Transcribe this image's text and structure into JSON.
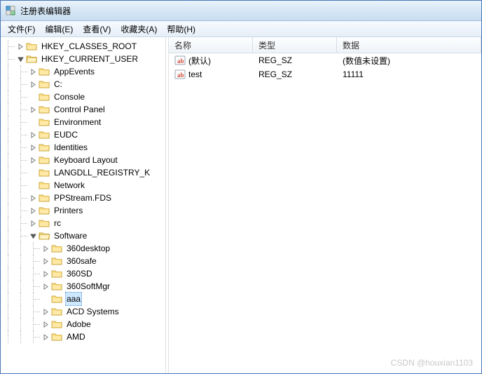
{
  "title": "注册表编辑器",
  "menus": [
    "文件(F)",
    "编辑(E)",
    "查看(V)",
    "收藏夹(A)",
    "帮助(H)"
  ],
  "columns": {
    "name": "名称",
    "type": "类型",
    "data": "数据"
  },
  "values": [
    {
      "name": "(默认)",
      "type": "REG_SZ",
      "data": "(数值未设置)",
      "icon": "string"
    },
    {
      "name": "test",
      "type": "REG_SZ",
      "data": "11111",
      "icon": "string"
    }
  ],
  "tree": {
    "hkcr": "HKEY_CLASSES_ROOT",
    "hkcu": "HKEY_CURRENT_USER",
    "hkcu_children": [
      {
        "k": "appEvents",
        "label": "AppEvents",
        "exp": "closed"
      },
      {
        "k": "c",
        "label": "C:",
        "exp": "closed"
      },
      {
        "k": "console",
        "label": "Console",
        "exp": "none"
      },
      {
        "k": "cp",
        "label": "Control Panel",
        "exp": "closed"
      },
      {
        "k": "env",
        "label": "Environment",
        "exp": "none"
      },
      {
        "k": "eudc",
        "label": "EUDC",
        "exp": "closed"
      },
      {
        "k": "ident",
        "label": "Identities",
        "exp": "closed"
      },
      {
        "k": "kb",
        "label": "Keyboard Layout",
        "exp": "closed"
      },
      {
        "k": "lang",
        "label": "LANGDLL_REGISTRY_K",
        "exp": "none"
      },
      {
        "k": "net",
        "label": "Network",
        "exp": "none"
      },
      {
        "k": "pps",
        "label": "PPStream.FDS",
        "exp": "closed"
      },
      {
        "k": "prn",
        "label": "Printers",
        "exp": "closed"
      },
      {
        "k": "rc",
        "label": "rc",
        "exp": "closed"
      },
      {
        "k": "sw",
        "label": "Software",
        "exp": "open"
      }
    ],
    "software_children": [
      {
        "k": "360d",
        "label": "360desktop",
        "exp": "closed"
      },
      {
        "k": "360s",
        "label": "360safe",
        "exp": "closed"
      },
      {
        "k": "360sd",
        "label": "360SD",
        "exp": "closed"
      },
      {
        "k": "360sm",
        "label": "360SoftMgr",
        "exp": "closed"
      },
      {
        "k": "aaa",
        "label": "aaa",
        "exp": "none",
        "selected": true
      },
      {
        "k": "acd",
        "label": "ACD Systems",
        "exp": "closed"
      },
      {
        "k": "adobe",
        "label": "Adobe",
        "exp": "closed"
      },
      {
        "k": "amd",
        "label": "AMD",
        "exp": "closed"
      }
    ]
  },
  "watermark": "CSDN @houxian1103"
}
